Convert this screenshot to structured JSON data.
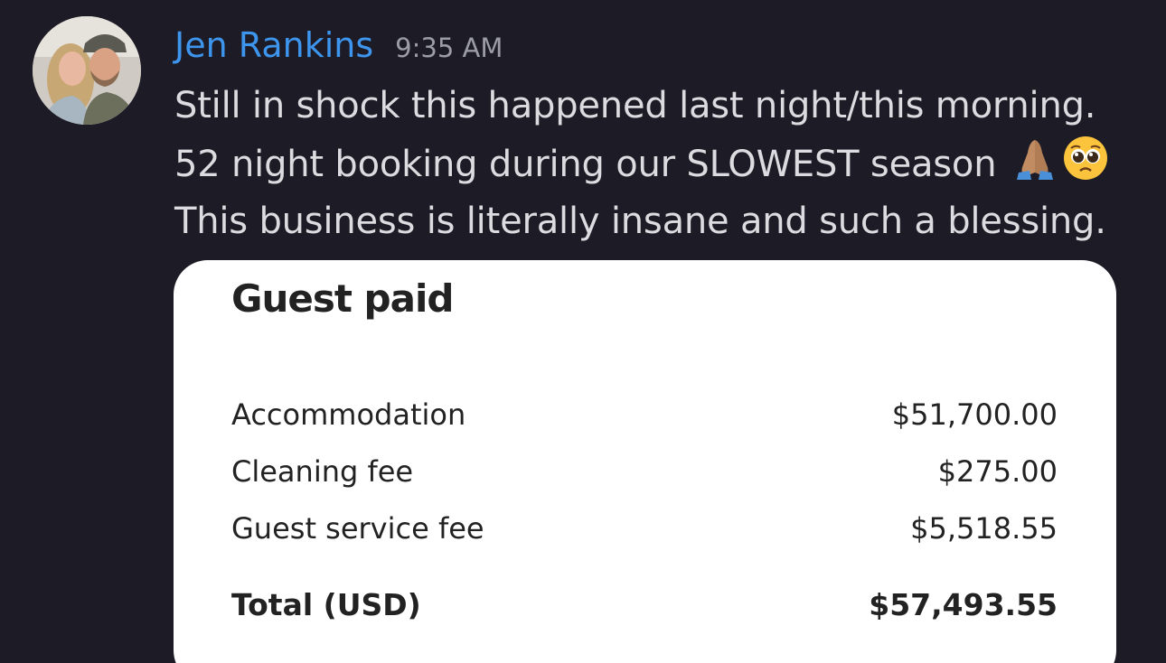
{
  "message": {
    "author": "Jen Rankins",
    "timestamp": "9:35 AM",
    "lines": [
      "Still in shock this happened last night/this morning.",
      "52 night booking during our SLOWEST season",
      "This business is literally insane and such a blessing."
    ],
    "emojis": [
      "folded-hands-icon",
      "pleading-face-icon"
    ]
  },
  "payment_card": {
    "title": "Guest paid",
    "items": [
      {
        "label": "Accommodation",
        "value": "$51,700.00"
      },
      {
        "label": "Cleaning fee",
        "value": "$275.00"
      },
      {
        "label": "Guest service fee",
        "value": "$5,518.55"
      }
    ],
    "total": {
      "label": "Total (USD)",
      "value": "$57,493.55"
    }
  },
  "colors": {
    "background": "#1d1c26",
    "author_name": "#3d95ee",
    "message_text": "#dcdce0",
    "timestamp": "#9c9ca8",
    "card_background": "#ffffff",
    "card_text": "#222222"
  }
}
